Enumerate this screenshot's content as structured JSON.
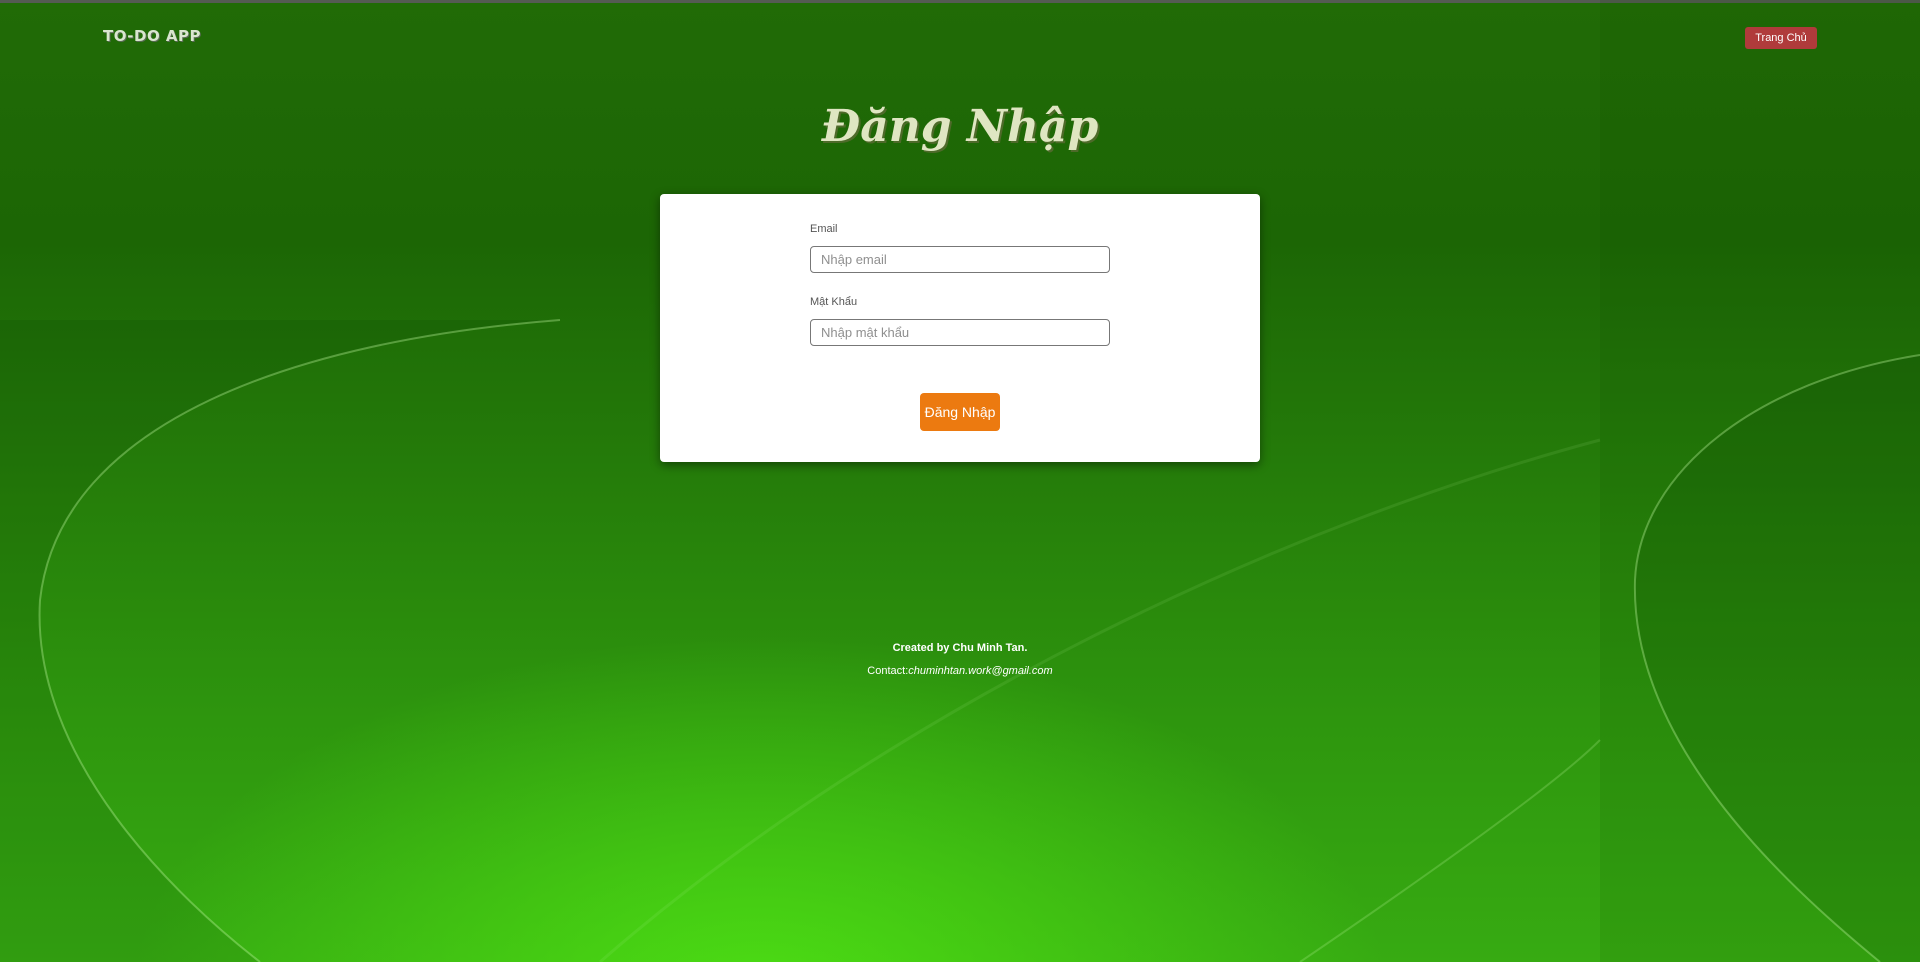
{
  "header": {
    "logo": "TO-DO APP",
    "home_button": "Trang Chủ"
  },
  "page": {
    "title": "Đăng Nhập"
  },
  "form": {
    "email": {
      "label": "Email",
      "placeholder": "Nhập email",
      "value": ""
    },
    "password": {
      "label": "Mật Khẩu",
      "placeholder": "Nhập mật khẩu",
      "value": ""
    },
    "submit_label": "Đăng Nhập"
  },
  "footer": {
    "created_by": "Created by Chu Minh Tan.",
    "contact_label": "Contact:",
    "contact_email": "chuminhtan.work@gmail.com"
  },
  "colors": {
    "background": "#257d0a",
    "home_button": "#b03b3b",
    "submit_button": "#ec7a10",
    "title": "#dfe6c2"
  }
}
